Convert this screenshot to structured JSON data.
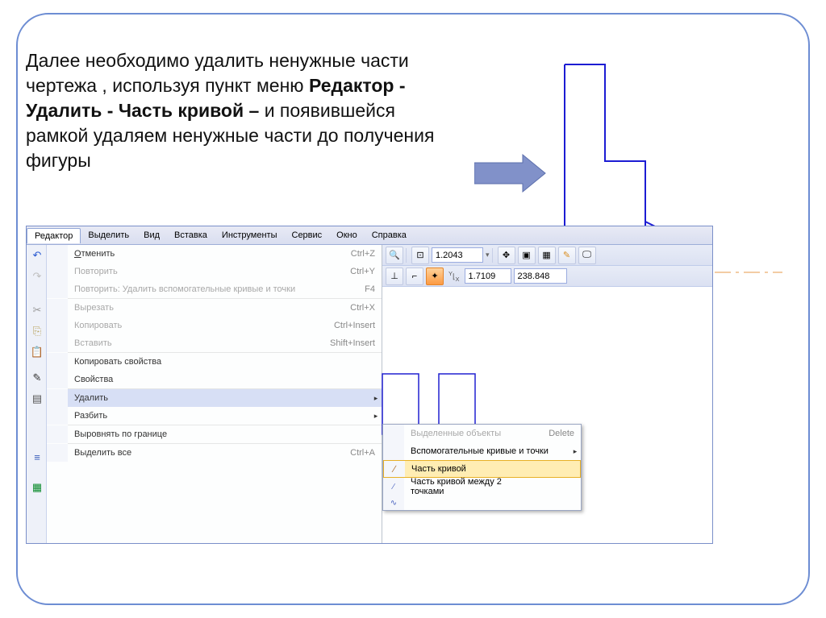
{
  "instruction": {
    "part1": "Далее необходимо удалить ненужные части чертежа , используя пункт меню ",
    "bold1": "Редактор - Удалить  - Часть кривой – ",
    "part2": "и появившейся рамкой удаляем ненужные части до получения  фигуры"
  },
  "menubar": [
    "Редактор",
    "Выделить",
    "Вид",
    "Вставка",
    "Инструменты",
    "Сервис",
    "Окно",
    "Справка"
  ],
  "menu": {
    "undo": {
      "label": "Отменить",
      "short": "Ctrl+Z"
    },
    "redo": {
      "label": "Повторить",
      "short": "Ctrl+Y"
    },
    "redo2": {
      "label": "Повторить: Удалить вспомогательные кривые и точки",
      "short": "F4"
    },
    "cut": {
      "label": "Вырезать",
      "short": "Ctrl+X"
    },
    "copy": {
      "label": "Копировать",
      "short": "Ctrl+Insert"
    },
    "paste": {
      "label": "Вставить",
      "short": "Shift+Insert"
    },
    "copyprops": {
      "label": "Копировать свойства"
    },
    "props": {
      "label": "Свойства"
    },
    "delete": {
      "label": "Удалить"
    },
    "split": {
      "label": "Разбить"
    },
    "align": {
      "label": "Выровнять по границе"
    },
    "selall": {
      "label": "Выделить все",
      "short": "Ctrl+A"
    }
  },
  "submenu": {
    "selected": {
      "label": "Выделенные объекты",
      "short": "Delete"
    },
    "aux": {
      "label": "Вспомогательные кривые и точки"
    },
    "curvepart": {
      "label": "Часть кривой"
    },
    "curvepart2": {
      "label": "Часть кривой между 2 точками"
    }
  },
  "toolbar": {
    "zoom": "1.2043",
    "xval": "1.7109",
    "yval": "238.848",
    "xprefix": "X",
    "yprefix": "Y"
  }
}
